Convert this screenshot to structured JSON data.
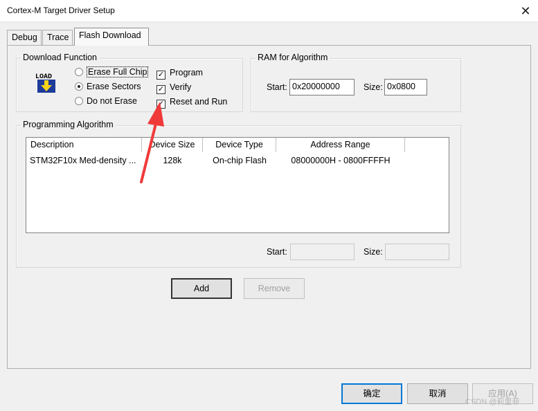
{
  "window": {
    "title": "Cortex-M Target Driver Setup",
    "close_glyph": "✕"
  },
  "tabs": [
    {
      "label": "Debug"
    },
    {
      "label": "Trace"
    },
    {
      "label": "Flash Download"
    }
  ],
  "download_function": {
    "title": "Download Function",
    "icon_text": "LOAD",
    "erase_options": [
      {
        "label": "Erase Full Chip",
        "selected": false
      },
      {
        "label": "Erase Sectors",
        "selected": true
      },
      {
        "label": "Do not Erase",
        "selected": false
      }
    ],
    "checkboxes": [
      {
        "label": "Program",
        "checked": true
      },
      {
        "label": "Verify",
        "checked": true
      },
      {
        "label": "Reset and Run",
        "checked": true
      }
    ]
  },
  "ram_for_algorithm": {
    "title": "RAM for Algorithm",
    "start_label": "Start:",
    "start_value": "0x20000000",
    "size_label": "Size:",
    "size_value": "0x0800"
  },
  "programming_algorithm": {
    "title": "Programming Algorithm",
    "columns": [
      "Description",
      "Device Size",
      "Device Type",
      "Address Range"
    ],
    "rows": [
      {
        "description": "STM32F10x Med-density ...",
        "device_size": "128k",
        "device_type": "On-chip Flash",
        "address_range": "08000000H - 0800FFFFH"
      }
    ],
    "start_label": "Start:",
    "start_value": "",
    "size_label": "Size:",
    "size_value": ""
  },
  "buttons": {
    "add": "Add",
    "remove": "Remove",
    "ok": "确定",
    "cancel": "取消",
    "apply": "应用(A)"
  },
  "watermark": "CSDN @莉里菲",
  "colors": {
    "arrow": "#f03a3a",
    "focus_blue": "#0078d7"
  }
}
